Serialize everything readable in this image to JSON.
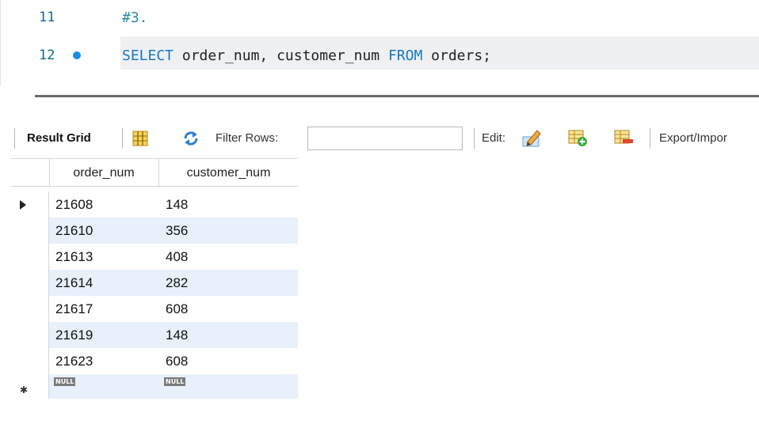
{
  "editor": {
    "lines": [
      {
        "number": "11",
        "text": "#3.",
        "has_marker": false
      },
      {
        "number": "12",
        "has_marker": true,
        "tokens": [
          {
            "text": "SELECT",
            "kind": "keyword"
          },
          {
            "text": " order_num, customer_num ",
            "kind": "plain"
          },
          {
            "text": "FROM",
            "kind": "keyword"
          },
          {
            "text": " orders;",
            "kind": "plain"
          }
        ]
      }
    ]
  },
  "toolbar": {
    "result_grid_label": "Result Grid",
    "filter_rows_label": "Filter Rows:",
    "filter_rows_value": "",
    "edit_label": "Edit:",
    "export_label": "Export/Impor"
  },
  "grid": {
    "columns": [
      "order_num",
      "customer_num"
    ],
    "rows": [
      [
        "21608",
        "148"
      ],
      [
        "21610",
        "356"
      ],
      [
        "21613",
        "408"
      ],
      [
        "21614",
        "282"
      ],
      [
        "21617",
        "608"
      ],
      [
        "21619",
        "148"
      ],
      [
        "21623",
        "608"
      ]
    ],
    "null_label": "NULL"
  },
  "icons": {
    "line_marker": "blue-dot-icon",
    "grid_layout": "grid-layout-icon",
    "refresh": "refresh-icon",
    "edit_pencil": "edit-row-icon",
    "add_row": "add-row-icon",
    "delete_row": "delete-row-icon"
  },
  "colors": {
    "keyword": "#1877c7",
    "line_number": "#0b6e8a",
    "alt_row": "#e8f0fb",
    "marker": "#1a8fe0"
  }
}
